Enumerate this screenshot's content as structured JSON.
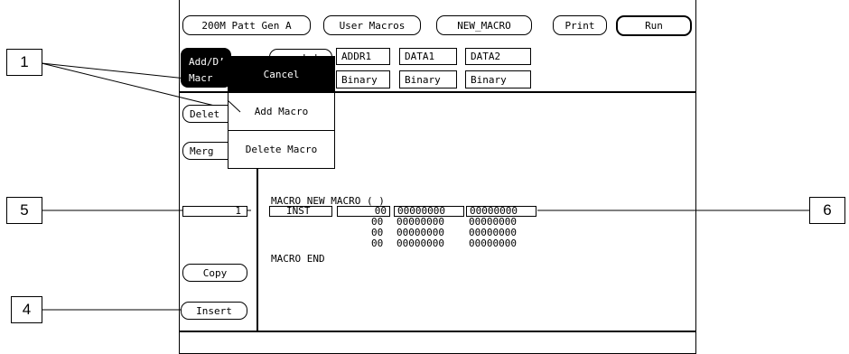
{
  "top_buttons": {
    "gen": "200M Patt Gen A",
    "user_macros": "User Macros",
    "macro_name": "NEW_MACRO",
    "print": "Print",
    "run": "Run"
  },
  "add_delete_button": {
    "line1": "Add/D’",
    "line2": "Macr"
  },
  "label_button_fragment": "Lab",
  "columns": [
    {
      "header": "ADDR1",
      "format": "Binary"
    },
    {
      "header": "DATA1",
      "format": "Binary"
    },
    {
      "header": "DATA2",
      "format": "Binary"
    }
  ],
  "popup_menu": {
    "cancel": "Cancel",
    "add_macro": "Add Macro",
    "delete_macro": "Delete Macro"
  },
  "left_buttons": {
    "delete": "Delet",
    "merge": "Merg",
    "copy": "Copy",
    "insert": "Insert"
  },
  "line_number": "1",
  "listing": {
    "header": "MACRO NEW_MACRO ( )",
    "inst_label": "INST",
    "rows": [
      {
        "addr": "00",
        "data1": "00000000",
        "data2": "00000000"
      },
      {
        "addr": "00",
        "data1": "00000000",
        "data2": "00000000"
      },
      {
        "addr": "00",
        "data1": "00000000",
        "data2": "00000000"
      },
      {
        "addr": "00",
        "data1": "00000000",
        "data2": "00000000"
      }
    ],
    "footer": "MACRO END"
  },
  "callouts": {
    "c1": "1",
    "c4": "4",
    "c5": "5",
    "c6": "6"
  }
}
